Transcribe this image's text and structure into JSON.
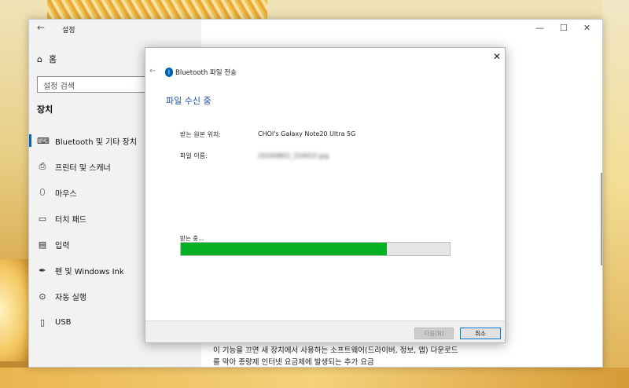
{
  "settings": {
    "title": "설정",
    "back_icon": "←",
    "home_label": "홈",
    "search_placeholder": "설정 검색",
    "section_title": "장치",
    "nav": [
      {
        "label": "Bluetooth 및 기타 장치",
        "icon": "bluetooth-devices-icon"
      },
      {
        "label": "프린터 및 스캐너",
        "icon": "printer-icon"
      },
      {
        "label": "마우스",
        "icon": "mouse-icon"
      },
      {
        "label": "터치 패드",
        "icon": "touchpad-icon"
      },
      {
        "label": "입력",
        "icon": "keyboard-icon"
      },
      {
        "label": "펜 및 Windows Ink",
        "icon": "pen-icon"
      },
      {
        "label": "자동 실행",
        "icon": "autoplay-icon"
      },
      {
        "label": "USB",
        "icon": "usb-icon"
      }
    ],
    "window_controls": {
      "minimize": "—",
      "maximize": "☐",
      "close": "✕"
    },
    "body_text": "이 기능을 끄면 새 장치에서 사용하는 소프트웨어(드라이버, 정보, 앱) 다운로드를 막아 종량제 인터넷 요금제에 발생되는 추가 요금"
  },
  "dialog": {
    "title": "Bluetooth 파일 전송",
    "heading": "파일 수신 중",
    "back_icon": "←",
    "close_icon": "✕",
    "source_label": "받는 원본 위치:",
    "source_value": "CHOI's Galaxy Note20 Ultra 5G",
    "filename_label": "파일 이름:",
    "filename_value": "20200803_154915.jpg",
    "progress_label": "받는 중...",
    "progress_fraction": 0.765,
    "next_button": "다음(N)",
    "cancel_button": "취소"
  },
  "colors": {
    "accent": "#0067c0",
    "progress": "#06b025",
    "heading": "#1a4c9c"
  }
}
